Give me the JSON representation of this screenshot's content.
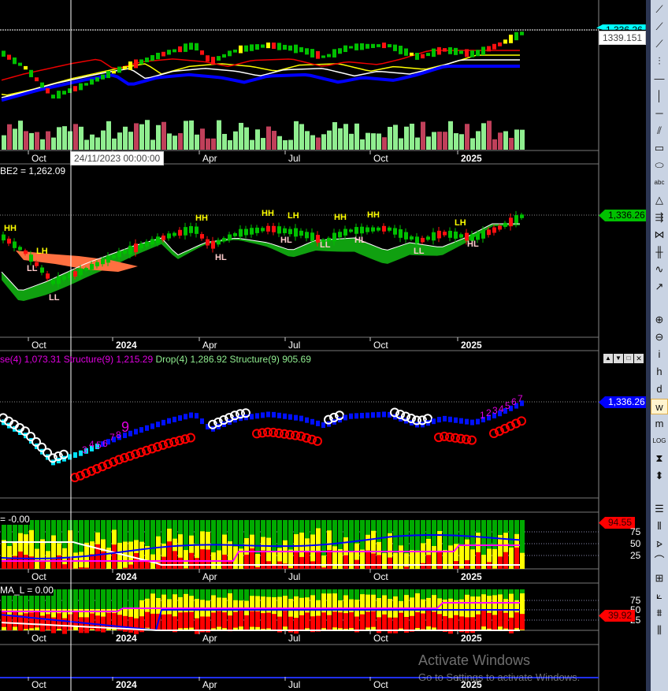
{
  "axis_labels": [
    "Oct",
    "2024",
    "Apr",
    "Jul",
    "Oct",
    "2025"
  ],
  "pane1": {
    "last_price_tag": "1,336.26",
    "crosshair_value": "1339.151",
    "crosshair_date": "24/11/2023 00:00:00"
  },
  "pane2": {
    "title": "BE2 = 1,262.09",
    "price_tag": "1,336.26",
    "pattern_labels": [
      "HH",
      "LH",
      "LL",
      "LL",
      "HH",
      "HL",
      "HH",
      "LH",
      "HL",
      "LL",
      "HH",
      "HL",
      "HH",
      "LL",
      "LH",
      "HL"
    ]
  },
  "pane3": {
    "title_parts": [
      {
        "text": "se(4) 1,073.31 Structure(9) 1,215.29",
        "color": "#e000e0"
      },
      {
        "text": " Drop(4) 1,286.92 Structure(9) 905.69",
        "color": "#90ee90"
      }
    ],
    "price_tag": "1,336.26",
    "count_left": [
      "3",
      "4",
      "5",
      "6",
      "7",
      "8",
      "9"
    ],
    "count_right": [
      "1",
      "2",
      "3",
      "4",
      "5",
      "6",
      "7"
    ],
    "window_buttons": [
      "▲",
      "▼",
      "□",
      "✕"
    ]
  },
  "pane4": {
    "title": "= -0.00",
    "value_tag": "94.55",
    "levels": [
      "75",
      "50",
      "25"
    ]
  },
  "pane5": {
    "title": "MA_L = 0.00",
    "value_tag": "39.92",
    "levels": [
      "75",
      "50",
      "25"
    ]
  },
  "colors": {
    "up": "#00a000",
    "down": "#e00000",
    "volume_down": "#c0405a",
    "volume_up": "#90ee90",
    "tag_green": "#00c000",
    "tag_blue": "#0000ff",
    "tag_red": "#ff0000"
  },
  "toolbar": [
    {
      "icon": "line-icon",
      "glyph": "⟋"
    },
    {
      "icon": "ray-icon",
      "glyph": "⟋"
    },
    {
      "icon": "extended-line-icon",
      "glyph": "⟋"
    },
    {
      "icon": "vertical-segment-icon",
      "glyph": "⫶"
    },
    {
      "icon": "horizontal-segment-icon",
      "glyph": "—"
    },
    {
      "icon": "vertical-line-icon",
      "glyph": "│"
    },
    {
      "icon": "horizontal-line-icon",
      "glyph": "─"
    },
    {
      "icon": "parallel-lines-icon",
      "glyph": "⫽"
    },
    {
      "icon": "rectangle-icon",
      "glyph": "▭"
    },
    {
      "icon": "ellipse-icon",
      "glyph": "⬭"
    },
    {
      "icon": "text-icon",
      "glyph": "abc"
    },
    {
      "icon": "triangle-icon",
      "glyph": "△"
    },
    {
      "icon": "arrow-icon",
      "glyph": "⇶"
    },
    {
      "icon": "cycles-icon",
      "glyph": "⋈"
    },
    {
      "icon": "gann-icon",
      "glyph": "╫"
    },
    {
      "icon": "zigzag-icon",
      "glyph": "∿"
    },
    {
      "icon": "arrow-line-icon",
      "glyph": "↗"
    },
    {
      "icon": "zoom-in-icon",
      "glyph": "⊕"
    },
    {
      "icon": "zoom-out-icon",
      "glyph": "⊖"
    },
    {
      "icon": "intraday-icon",
      "glyph": "i"
    },
    {
      "icon": "hourly-icon",
      "glyph": "h"
    },
    {
      "icon": "daily-icon",
      "glyph": "d"
    },
    {
      "icon": "weekly-icon",
      "glyph": "w"
    },
    {
      "icon": "monthly-icon",
      "glyph": "m"
    },
    {
      "icon": "log-scale-icon",
      "glyph": "LOG"
    },
    {
      "icon": "fit-icon",
      "glyph": "⧗"
    },
    {
      "icon": "scroll-icon",
      "glyph": "⬍"
    },
    {
      "icon": "list-icon",
      "glyph": "☰"
    },
    {
      "icon": "bars-icon",
      "glyph": "⦀"
    },
    {
      "icon": "fib-fan-icon",
      "glyph": "⦠"
    },
    {
      "icon": "arcs-icon",
      "glyph": "⌒"
    },
    {
      "icon": "grid-icon",
      "glyph": "⊞"
    },
    {
      "icon": "gann-fan-icon",
      "glyph": "⟀"
    },
    {
      "icon": "fib-retracement-icon",
      "glyph": "⩩"
    },
    {
      "icon": "timezones-icon",
      "glyph": "⫼"
    }
  ],
  "watermark": {
    "title": "Activate Windows",
    "subtitle": "Go to Settings to activate Windows."
  }
}
